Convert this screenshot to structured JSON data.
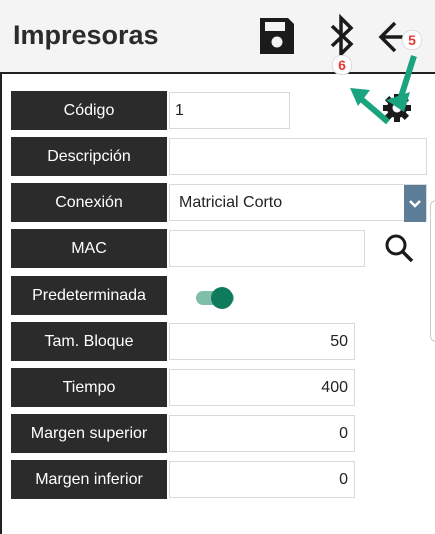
{
  "header": {
    "title": "Impresoras",
    "icons": [
      "save-icon",
      "bluetooth-icon",
      "back-arrow-icon",
      "gear-icon"
    ],
    "badges": {
      "back": "5",
      "bluetooth": "6"
    },
    "annotation_color": "#19a37e"
  },
  "form": {
    "codigo": {
      "label": "Código",
      "value": "1"
    },
    "descripcion": {
      "label": "Descripción",
      "value": ""
    },
    "conexion": {
      "label": "Conexión",
      "value": "Matricial Corto"
    },
    "mac": {
      "label": "MAC",
      "value": ""
    },
    "predeterminada": {
      "label": "Predeterminada",
      "on": true
    },
    "tam_bloque": {
      "label": "Tam. Bloque",
      "value": "50"
    },
    "tiempo": {
      "label": "Tiempo",
      "value": "400"
    },
    "margen_superior": {
      "label": "Margen superior",
      "value": "0"
    },
    "margen_inferior": {
      "label": "Margen inferior",
      "value": "0"
    }
  },
  "colors": {
    "label_bg": "#2b2b2b",
    "toggle_on": "#0f7a5c",
    "select_arrow": "#5e7e98",
    "badge_text": "#e53935"
  }
}
